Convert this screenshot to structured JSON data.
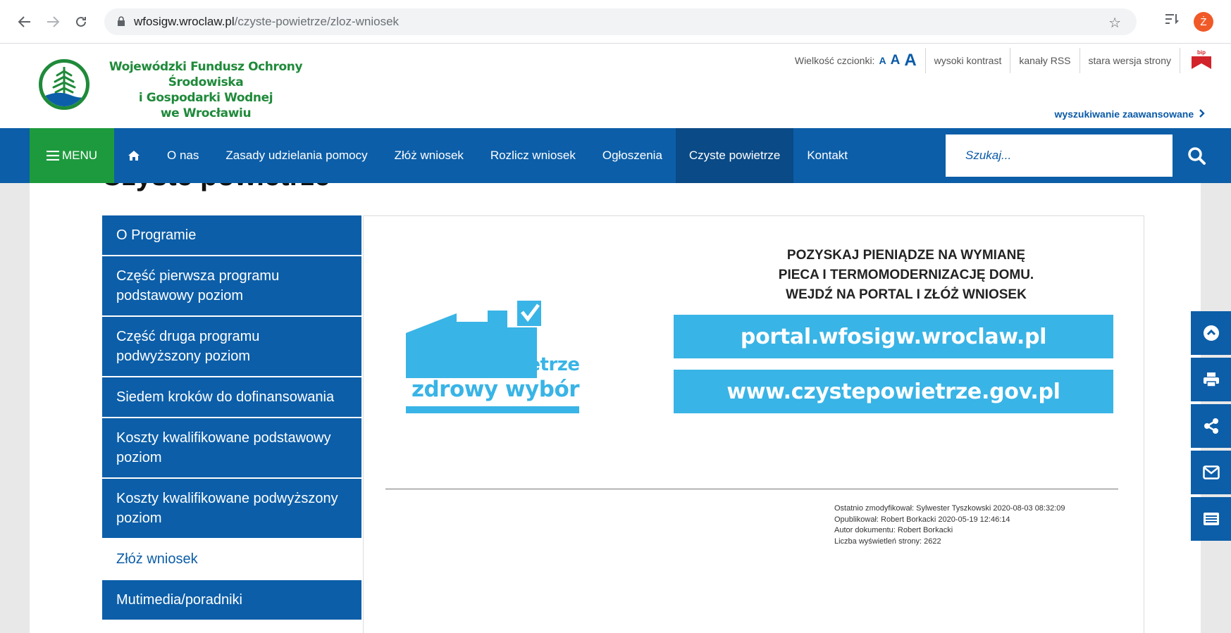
{
  "browser": {
    "url_host": "wfosigw.wroclaw.pl",
    "url_path": "/czyste-powietrze/zloz-wniosek",
    "profile_initial": "Ż"
  },
  "header": {
    "org_line1": "Wojewódzki Fundusz Ochrony Środowiska",
    "org_line2": "i Gospodarki Wodnej",
    "org_line3": "we Wrocławiu",
    "font_size_label": "Wielkość czcionki:",
    "font_a_small": "A",
    "font_a_medium": "A",
    "font_a_large": "A",
    "high_contrast": "wysoki kontrast",
    "rss": "kanały RSS",
    "old_version": "stara wersja strony",
    "bip": "bip",
    "advanced_search": "wyszukiwanie zaawansowane"
  },
  "nav": {
    "menu_label": "MENU",
    "items": [
      "O nas",
      "Zasady udzielania pomocy",
      "Złóż wniosek",
      "Rozlicz wniosek",
      "Ogłoszenia",
      "Czyste powietrze",
      "Kontakt"
    ],
    "active_index": 5,
    "search_placeholder": "Szukaj..."
  },
  "page": {
    "title": "Czyste powietrze"
  },
  "sidebar": {
    "items": [
      "O Programie",
      "Część pierwsza programu podstawowy poziom",
      "Część druga programu podwyższony poziom",
      "Siedem kroków do dofinansowania",
      "Koszty kwalifikowane podstawowy poziom",
      "Koszty kwalifikowane podwyższony poziom",
      "Złóż wniosek",
      "Mutimedia/poradniki"
    ],
    "active_index": 6
  },
  "banner": {
    "logo_line1": "czyste powietrze",
    "logo_line2": "zdrowy wybór",
    "promo_line1": "POZYSKAJ PIENIĄDZE NA WYMIANĘ",
    "promo_line2": "PIECA I TERMOMODERNIZACJĘ DOMU.",
    "promo_line3": "WEJDŹ NA PORTAL I ZŁÓŻ WNIOSEK",
    "portal_link": "portal.wfosigw.wroclaw.pl",
    "gov_link": "www.czystepowietrze.gov.pl"
  },
  "meta": {
    "modified": "Ostatnio zmodyfikował: Sylwester Tyszkowski 2020-08-03 08:32:09",
    "published": "Opublikował: Robert Borkacki 2020-05-19 12:46:14",
    "author": "Autor dokumentu: Robert Borkacki",
    "views": "Liczba wyświetleń strony: 2622"
  },
  "colors": {
    "nav_blue": "#0c5ea8",
    "menu_green": "#1e9a3e",
    "sky_blue": "#39b4e6",
    "logo_green": "#1f8a3a"
  }
}
